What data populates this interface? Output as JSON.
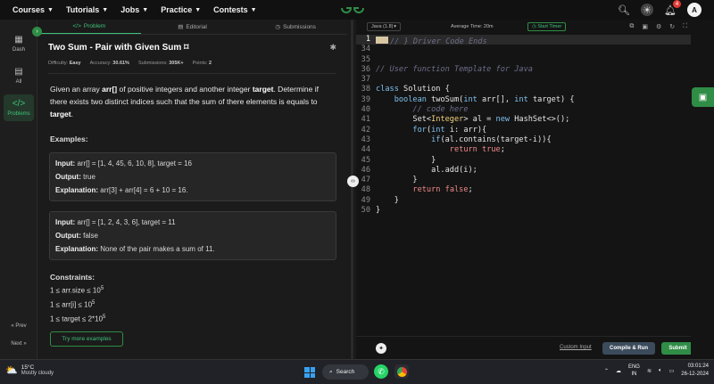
{
  "nav": {
    "items": [
      "Courses",
      "Tutorials",
      "Jobs",
      "Practice",
      "Contests"
    ],
    "notification_count": "4",
    "avatar_letter": "A"
  },
  "rail": {
    "items": [
      {
        "label": "Dash",
        "icon": "dashboard-icon"
      },
      {
        "label": "All",
        "icon": "grid-icon"
      },
      {
        "label": "Problems",
        "icon": "code-icon"
      }
    ],
    "prev": "« Prev",
    "next": "Next »"
  },
  "tabs": [
    {
      "label": "Problem",
      "icon": "code-icon"
    },
    {
      "label": "Editorial",
      "icon": "document-icon"
    },
    {
      "label": "Submissions",
      "icon": "clock-icon"
    }
  ],
  "problem": {
    "title": "Two Sum - Pair with Given Sum",
    "difficulty_label": "Difficulty:",
    "difficulty": "Easy",
    "accuracy_label": "Accuracy:",
    "accuracy": "30.61%",
    "submissions_label": "Submissions:",
    "submissions": "305K+",
    "points_label": "Points:",
    "points": "2",
    "desc_1": "Given an array ",
    "desc_arr": "arr[]",
    "desc_2": " of positive integers and another integer ",
    "desc_target": "target",
    "desc_3": ". Determine if there exists two distinct indices such that the sum of there elements is equals to ",
    "desc_target2": "target",
    "desc_4": ".",
    "examples_heading": "Examples:",
    "examples": [
      {
        "input_label": "Input:",
        "input": "arr[] = [1, 4, 45, 6, 10, 8], target = 16",
        "output_label": "Output:",
        "output": "true",
        "explanation_label": "Explanation:",
        "explanation": "arr[3] + arr[4] = 6 + 10 = 16."
      },
      {
        "input_label": "Input:",
        "input": "arr[] = [1, 2, 4, 3, 6], target = 11",
        "output_label": "Output:",
        "output": "false",
        "explanation_label": "Explanation:",
        "explanation": "None of the pair makes a sum of 11."
      }
    ],
    "constraints_heading": "Constraints:",
    "constraints": [
      {
        "text": "1 ≤ arr.size ≤ 10",
        "sup": "5"
      },
      {
        "text": "1 ≤ arr[i] ≤ 10",
        "sup": "5"
      },
      {
        "text": "1 ≤ target ≤ 2*10",
        "sup": "5"
      }
    ],
    "more_examples": "Try more examples"
  },
  "editor": {
    "language": "Java (1.8)",
    "avg_time": "Average Time: 20m",
    "start_timer": "Start Timer",
    "lines": [
      {
        "n": "1",
        "cur": true,
        "parts": [
          [
            "fold",
            ""
          ],
          [
            "cm",
            "// } Driver Code Ends"
          ]
        ]
      },
      {
        "n": "34",
        "parts": []
      },
      {
        "n": "35",
        "parts": []
      },
      {
        "n": "36",
        "parts": [
          [
            "cm",
            "// User function Template for Java"
          ]
        ]
      },
      {
        "n": "37",
        "parts": []
      },
      {
        "n": "38",
        "parts": [
          [
            "kw",
            "class"
          ],
          [
            "txt",
            " Solution {"
          ]
        ]
      },
      {
        "n": "39",
        "parts": [
          [
            "txt",
            "    "
          ],
          [
            "kw",
            "boolean"
          ],
          [
            "txt",
            " twoSum("
          ],
          [
            "kw",
            "int"
          ],
          [
            "txt",
            " arr[], "
          ],
          [
            "kw",
            "int"
          ],
          [
            "txt",
            " target) {"
          ]
        ]
      },
      {
        "n": "40",
        "parts": [
          [
            "txt",
            "        "
          ],
          [
            "cm",
            "// code here"
          ]
        ]
      },
      {
        "n": "41",
        "parts": [
          [
            "txt",
            "        Set<"
          ],
          [
            "ty",
            "Integer"
          ],
          [
            "txt",
            "> al = "
          ],
          [
            "kw",
            "new"
          ],
          [
            "txt",
            " HashSet<>();"
          ]
        ]
      },
      {
        "n": "42",
        "parts": [
          [
            "txt",
            "        "
          ],
          [
            "kw",
            "for"
          ],
          [
            "txt",
            "("
          ],
          [
            "kw",
            "int"
          ],
          [
            "txt",
            " i: arr){"
          ]
        ]
      },
      {
        "n": "43",
        "parts": [
          [
            "txt",
            "            "
          ],
          [
            "kw",
            "if"
          ],
          [
            "txt",
            "(al.contains(target-i)){"
          ]
        ]
      },
      {
        "n": "44",
        "parts": [
          [
            "txt",
            "                "
          ],
          [
            "kw2",
            "return"
          ],
          [
            "txt",
            " "
          ],
          [
            "kw2",
            "true"
          ],
          [
            "txt",
            ";"
          ]
        ]
      },
      {
        "n": "45",
        "parts": [
          [
            "txt",
            "            }"
          ]
        ]
      },
      {
        "n": "46",
        "parts": [
          [
            "txt",
            "            al.add(i);"
          ]
        ]
      },
      {
        "n": "47",
        "parts": [
          [
            "txt",
            "        }"
          ]
        ]
      },
      {
        "n": "48",
        "parts": [
          [
            "txt",
            "        "
          ],
          [
            "kw2",
            "return"
          ],
          [
            "txt",
            " "
          ],
          [
            "kw2",
            "false"
          ],
          [
            "txt",
            ";"
          ]
        ]
      },
      {
        "n": "49",
        "parts": [
          [
            "txt",
            "    }"
          ]
        ]
      },
      {
        "n": "50",
        "parts": [
          [
            "txt",
            "}"
          ]
        ]
      }
    ],
    "custom_input": "Custom Input",
    "compile_run": "Compile & Run",
    "submit": "Submit"
  },
  "taskbar": {
    "temperature": "15°C",
    "weather": "Mostly cloudy",
    "search": "Search",
    "lang_1": "ENG",
    "lang_2": "IN",
    "time": "03:01:24",
    "date": "26-12-2024"
  },
  "colors": {
    "accent_green": "#2f8d46",
    "text_green": "#3ec27a",
    "editor_bg": "#141414",
    "panel_bg": "#1b1b1b"
  }
}
